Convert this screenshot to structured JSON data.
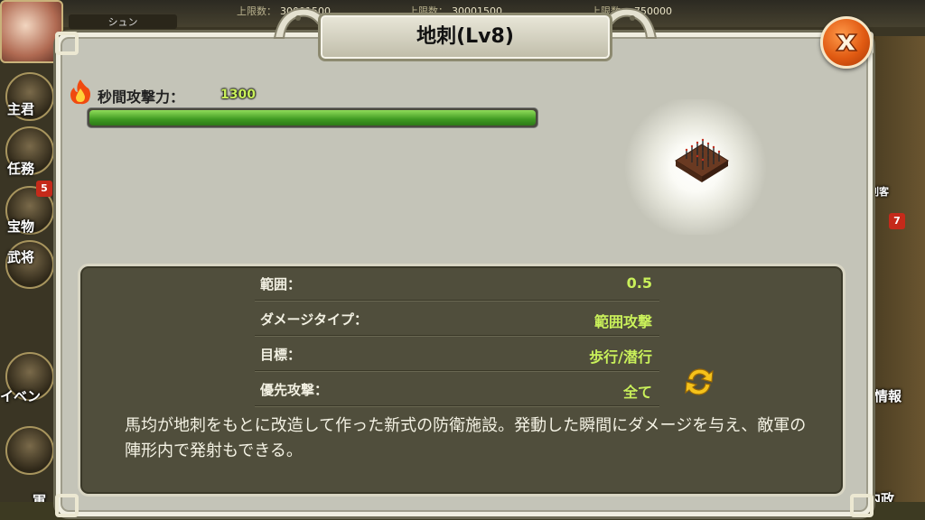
{
  "header": {
    "player_name": "シュン",
    "stats": [
      {
        "label": "上限数：",
        "value": "30001500"
      },
      {
        "label": "上限数：",
        "value": "30001500"
      },
      {
        "label": "上限数：",
        "value": "750000"
      }
    ]
  },
  "left_menu": {
    "items": [
      {
        "label": "主君",
        "badge": ""
      },
      {
        "label": "任務",
        "badge": ""
      },
      {
        "label": "宝物",
        "badge": "5"
      },
      {
        "label": "武将",
        "badge": ""
      },
      {
        "label": "イベン",
        "badge": ""
      },
      {
        "label": "軍",
        "badge": ""
      }
    ]
  },
  "right_menu": {
    "items": [
      {
        "label": "刺客"
      },
      {
        "label": "情報"
      },
      {
        "label": "内政"
      }
    ],
    "badge": "7"
  },
  "dialog": {
    "title": "地刺(Lv8)",
    "attack_label": "秒間攻撃力：",
    "attack_value": "1300",
    "attack_bar_fraction": 1.0,
    "stats": [
      {
        "label": "範囲：",
        "value": "0.5"
      },
      {
        "label": "ダメージタイプ：",
        "value": "範囲攻撃"
      },
      {
        "label": "目標：",
        "value": "歩行/潜行"
      },
      {
        "label": "優先攻撃：",
        "value": "全て"
      }
    ],
    "description": "馬均が地刺をもとに改造して作った新式の防衛施設。発動した瞬間にダメージを与え、敵軍の陣形内で発射もできる。"
  },
  "icons": {
    "close": "close-icon",
    "fire": "fire-icon",
    "cycle": "cycle-arrows-icon",
    "building": "spike-trap-icon"
  },
  "colors": {
    "value_green": "#c9f05a",
    "bar_green": "#3f9a22",
    "close_orange": "#e05a12"
  }
}
